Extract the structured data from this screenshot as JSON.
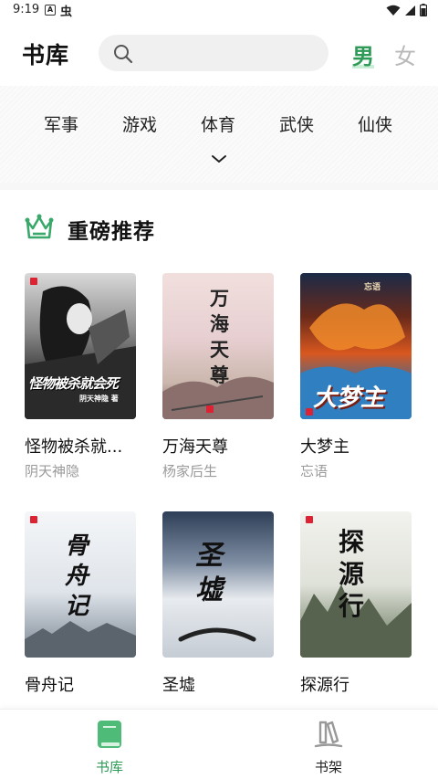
{
  "status_bar": {
    "time": "9:19",
    "indicator_a": "A",
    "indicator_bug": "虫",
    "icons": [
      "wifi-icon",
      "signal-icon",
      "battery-icon"
    ]
  },
  "header": {
    "title": "书库",
    "search_placeholder": "",
    "gender_male": "男",
    "gender_female": "女",
    "accent_color": "#2e9a57"
  },
  "categories": {
    "items": [
      "军事",
      "游戏",
      "体育",
      "武侠",
      "仙侠"
    ],
    "expand_icon": "chevron-down-icon"
  },
  "section": {
    "title": "重磅推荐",
    "icon": "crown-icon"
  },
  "books": [
    {
      "title": "怪物被杀就...",
      "author": "阴天神隐",
      "cover_text": "怪物被杀就会死",
      "cover_sub": "阴天神隐 著"
    },
    {
      "title": "万海天尊",
      "author": "杨家后生",
      "cover_text": "万海天尊",
      "cover_sub": ""
    },
    {
      "title": "大梦主",
      "author": "忘语",
      "cover_text": "大梦主",
      "cover_sub": "忘语"
    },
    {
      "title": "骨舟记",
      "author": "",
      "cover_text": "骨舟记",
      "cover_sub": ""
    },
    {
      "title": "圣墟",
      "author": "",
      "cover_text": "圣墟",
      "cover_sub": ""
    },
    {
      "title": "探源行",
      "author": "",
      "cover_text": "探源行",
      "cover_sub": ""
    }
  ],
  "bottom_nav": {
    "items": [
      {
        "label": "书库",
        "icon": "book-icon",
        "active": true
      },
      {
        "label": "书架",
        "icon": "bookshelf-icon",
        "active": false
      }
    ]
  }
}
